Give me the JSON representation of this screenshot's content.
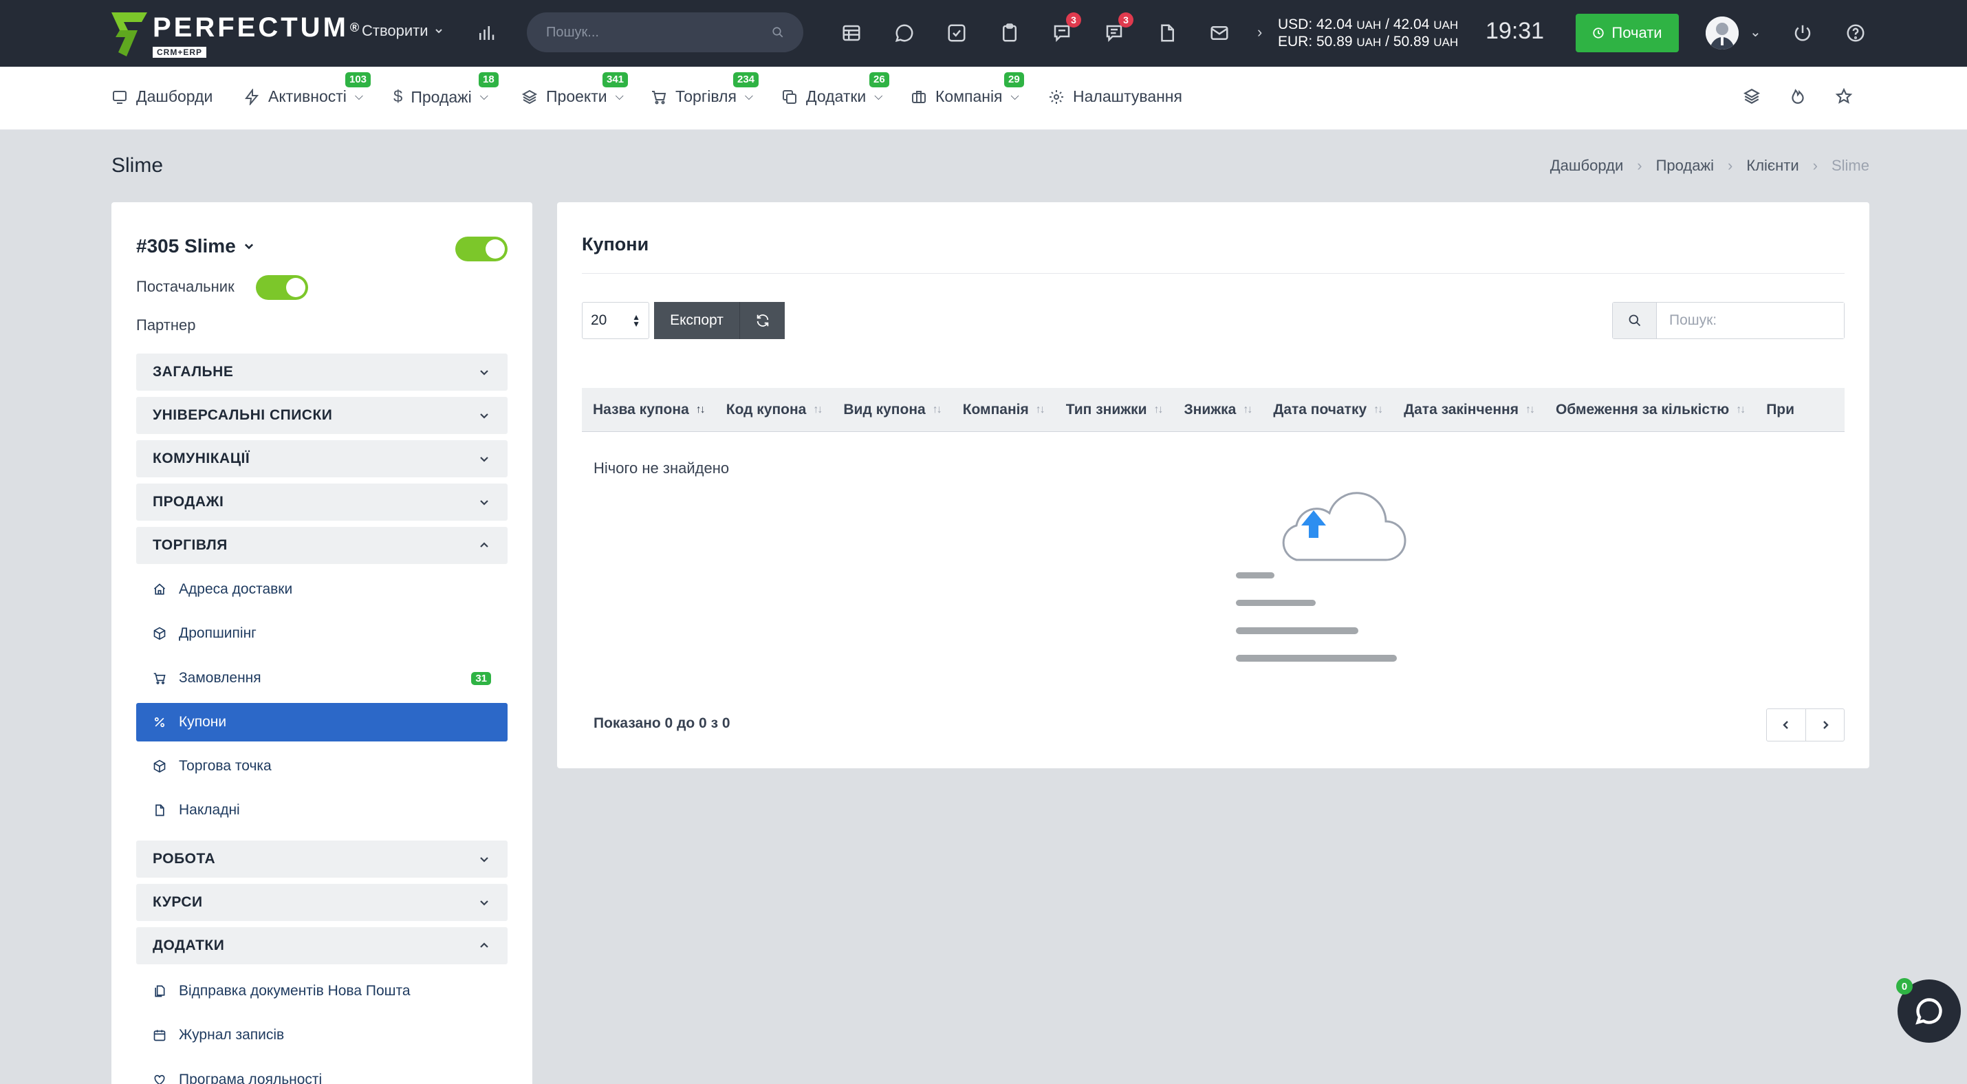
{
  "topbar": {
    "logo_name": "PERFECTUM",
    "logo_reg": "®",
    "logo_sub": "CRM+ERP",
    "create_label": "Створити",
    "search_placeholder": "Пошук...",
    "badge_chat": "3",
    "badge_messages": "3",
    "usd_label": "USD: 42.04",
    "usd_unit1": "UAH",
    "usd_sep": "/ 42.04",
    "usd_unit2": "UAH",
    "eur_label": "EUR: 50.89",
    "eur_unit1": "UAH",
    "eur_sep": "/ 50.89",
    "eur_unit2": "UAH",
    "time": "19:31",
    "start_label": "Почати",
    "icons": [
      "bar-chart-icon",
      "table-icon",
      "chat-bubble-icon",
      "task-check-icon",
      "clipboard-icon",
      "comments-icon",
      "messages-icon",
      "document-icon",
      "mail-icon",
      "power-icon",
      "help-icon"
    ]
  },
  "menu": {
    "items": [
      {
        "label": "Дашборди",
        "badge": ""
      },
      {
        "label": "Активності",
        "badge": "103"
      },
      {
        "label": "Продажі",
        "badge": "18"
      },
      {
        "label": "Проекти",
        "badge": "341"
      },
      {
        "label": "Торгівля",
        "badge": "234"
      },
      {
        "label": "Додатки",
        "badge": "26"
      },
      {
        "label": "Компанія",
        "badge": "29"
      },
      {
        "label": "Налаштування",
        "badge": ""
      }
    ]
  },
  "page": {
    "title": "Slime",
    "breadcrumb": [
      "Дашборди",
      "Продажі",
      "Клієнти",
      "Slime"
    ]
  },
  "sidebar": {
    "client_name": "#305 Slime",
    "supplier_label": "Постачальник",
    "partner_label": "Партнер",
    "sections": {
      "general": "ЗАГАЛЬНЕ",
      "universal_lists": "УНІВЕРСАЛЬНІ СПИСКИ",
      "communications": "КОМУНІКАЦІЇ",
      "sales": "ПРОДАЖІ",
      "trade": "ТОРГІВЛЯ",
      "work": "РОБОТА",
      "courses": "КУРСИ",
      "addons": "ДОДАТКИ"
    },
    "trade_items": {
      "delivery": "Адреса доставки",
      "dropshipping": "Дропшипінг",
      "orders": "Замовлення",
      "orders_badge": "31",
      "coupons": "Купони",
      "outlet": "Торгова точка",
      "invoices": "Накладні"
    },
    "addon_items": {
      "nova_poshta": "Відправка документів Нова Пошта",
      "journal": "Журнал записів",
      "loyalty": "Програма лояльності"
    }
  },
  "main": {
    "title": "Купони",
    "page_size": "20",
    "export_label": "Експорт",
    "search_placeholder": "Пошук:",
    "columns": [
      "Назва купона",
      "Код купона",
      "Вид купона",
      "Компанія",
      "Тип знижки",
      "Знижка",
      "Дата початку",
      "Дата закінчення",
      "Обмеження за кількістю",
      "При"
    ],
    "empty_text": "Нічого не знайдено",
    "info_text": "Показано 0 до 0 з 0"
  },
  "chat": {
    "badge": "0"
  },
  "colors": {
    "topbar_bg": "#252b36",
    "accent_green": "#2fb344",
    "toggle_green": "#7cc72a",
    "active_blue": "#2c68c8",
    "badge_red": "#e03a4e",
    "page_bg": "#dcdfe3"
  }
}
